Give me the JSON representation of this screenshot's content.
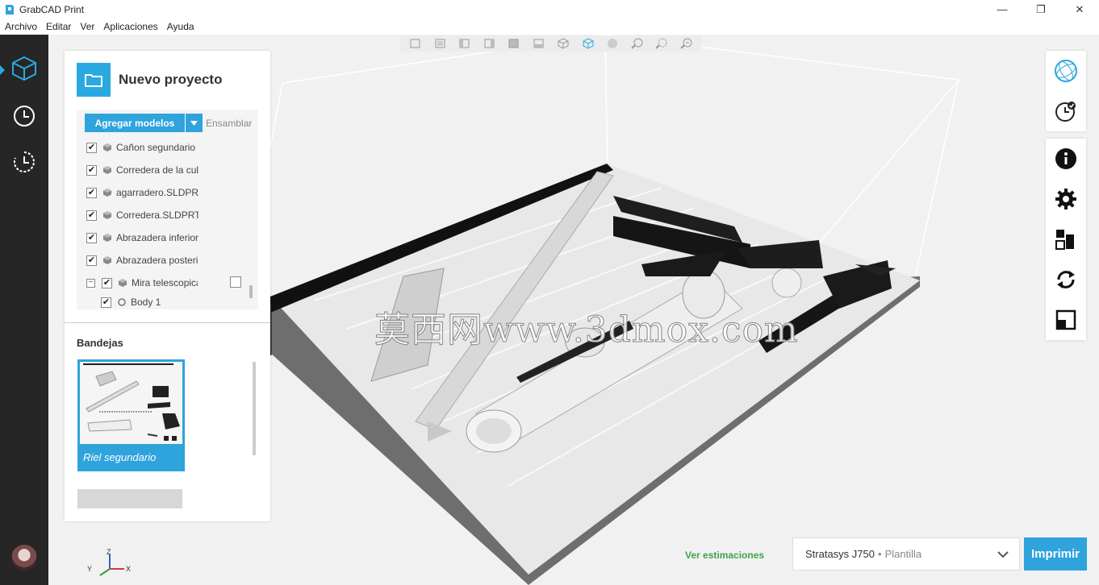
{
  "window": {
    "title": "GrabCAD Print",
    "controls": {
      "minimize": "—",
      "restore": "❐",
      "close": "✕"
    }
  },
  "menu": [
    "Archivo",
    "Editar",
    "Ver",
    "Aplicaciones",
    "Ayuda"
  ],
  "rail": {
    "items": [
      {
        "icon": "cube-icon",
        "active": true
      },
      {
        "icon": "clock-icon",
        "active": false
      },
      {
        "icon": "history-icon",
        "active": false
      }
    ],
    "accent": "#29a9e0"
  },
  "view_toolbar": {
    "icons": [
      "view-front-icon",
      "view-back-icon",
      "view-left-icon",
      "view-right-icon",
      "view-top-icon",
      "view-bottom-icon",
      "view-iso-icon",
      "view-iso-active-icon",
      "shade-icon",
      "zoom-icon",
      "zoom-fit-icon",
      "zoom-select-icon"
    ]
  },
  "project": {
    "title": "Nuevo proyecto",
    "add_models_label": "Agregar modelos",
    "assemble_label": "Ensamblar",
    "models": [
      {
        "name": "Cañon segundario",
        "checked": true
      },
      {
        "name": "Corredera de la culata",
        "checked": true
      },
      {
        "name": "agarradero.SLDPRT",
        "checked": true
      },
      {
        "name": "Corredera.SLDPRT",
        "checked": true
      },
      {
        "name": "Abrazadera inferior",
        "checked": true
      },
      {
        "name": "Abrazadera posterior",
        "checked": true
      },
      {
        "name": "Mira telescopica",
        "checked": true,
        "expanded": true
      },
      {
        "name": "Body 1",
        "checked": true,
        "child": true
      }
    ],
    "trays_title": "Bandejas",
    "trays": [
      {
        "name": "Riel segundario",
        "selected": true
      }
    ]
  },
  "right_tools": {
    "group1": [
      "globe-icon",
      "time-check-icon"
    ],
    "group2": [
      "info-icon",
      "settings-icon",
      "arrange-icon",
      "rotate-icon",
      "scale-icon"
    ]
  },
  "bottom": {
    "estimates_label": "Ver estimaciones",
    "printer_name": "Stratasys J750",
    "printer_separator": "•",
    "printer_template": "Plantilla",
    "print_label": "Imprimir",
    "estimates_color": "#3fa34d",
    "accent_color": "#2ea3dc"
  },
  "axis_labels": {
    "x": "X",
    "y": "Y",
    "z": "Z"
  },
  "watermark": "莫西网www.3dmox.com"
}
